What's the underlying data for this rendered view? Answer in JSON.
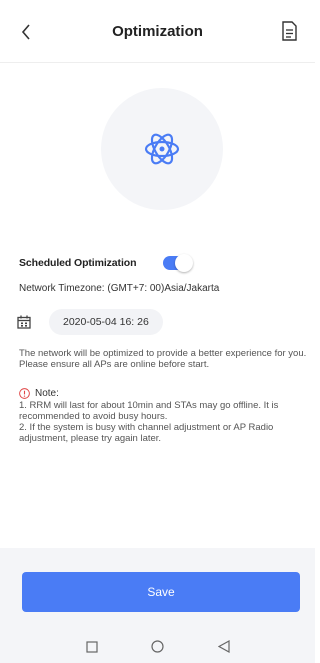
{
  "header": {
    "title": "Optimization",
    "back_icon": "chevron-left-icon",
    "doc_icon": "document-icon"
  },
  "hero": {
    "icon": "atom-icon",
    "accent": "#4a7cf5"
  },
  "schedule": {
    "label": "Scheduled Optimization",
    "enabled": true,
    "timezone": "Network Timezone: (GMT+7: 00)Asia/Jakarta",
    "datetime": "2020-05-04 16: 26"
  },
  "description": "The network will be optimized to provide a better experience for you. Please ensure all APs are online before start.",
  "note": {
    "title": "Note:",
    "lines": [
      "1. RRM will last for about 10min and STAs may go offline. It is recommended to avoid busy hours.",
      "2. If the system is busy with channel adjustment or AP Radio adjustment, please try again later."
    ]
  },
  "actions": {
    "save_label": "Save"
  },
  "colors": {
    "primary": "#4a7cf5",
    "hero_bg": "#f4f5f8",
    "warning": "#e04646"
  }
}
